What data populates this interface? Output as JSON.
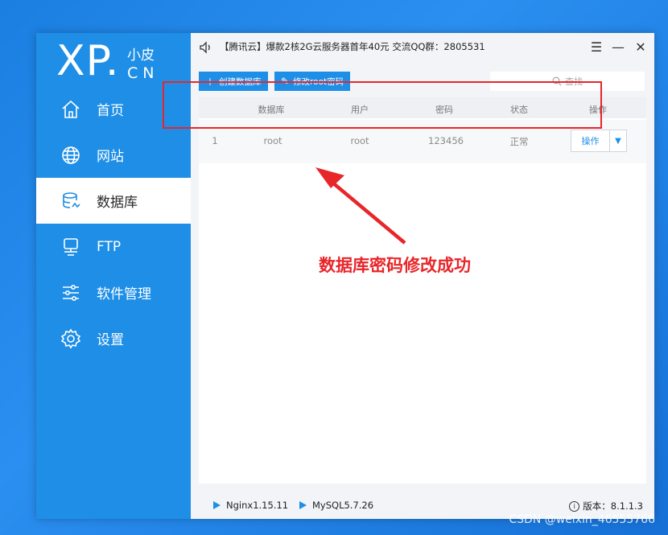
{
  "app": {
    "logo_main": "XP.",
    "logo_cn": "小皮",
    "logo_domain": "CN"
  },
  "sidebar": {
    "items": [
      {
        "label": "首页",
        "icon": "home-icon",
        "active": false
      },
      {
        "label": "网站",
        "icon": "globe-icon",
        "active": false
      },
      {
        "label": "数据库",
        "icon": "database-icon",
        "active": true
      },
      {
        "label": "FTP",
        "icon": "server-icon",
        "active": false
      },
      {
        "label": "软件管理",
        "icon": "sliders-icon",
        "active": false
      },
      {
        "label": "设置",
        "icon": "gear-icon",
        "active": false
      }
    ]
  },
  "topbar": {
    "notice": "【腾讯云】爆款2核2G云服务器首年40元 交流QQ群：2805531",
    "menu_glyph": "☰",
    "minimize_glyph": "—",
    "close_glyph": "✕"
  },
  "toolbar": {
    "create_db_label": "创建数据库",
    "change_root_pwd_label": "修改root密码",
    "search_placeholder": "查找"
  },
  "table": {
    "columns": [
      "数据库",
      "用户",
      "密码",
      "状态",
      "操作"
    ],
    "rows": [
      {
        "index": "1",
        "database": "root",
        "user": "root",
        "password": "123456",
        "status": "正常",
        "action": "操作"
      }
    ]
  },
  "annotation": {
    "text": "数据库密码修改成功",
    "color": "#e8262a"
  },
  "statusbar": {
    "nginx": "Nginx1.15.11",
    "mysql": "MySQL5.7.26",
    "version": "版本：8.1.1.3"
  },
  "watermark": "CSDN @weixin_46555766",
  "colors": {
    "accent": "#1e8ee6",
    "highlight": "#e8262a"
  }
}
